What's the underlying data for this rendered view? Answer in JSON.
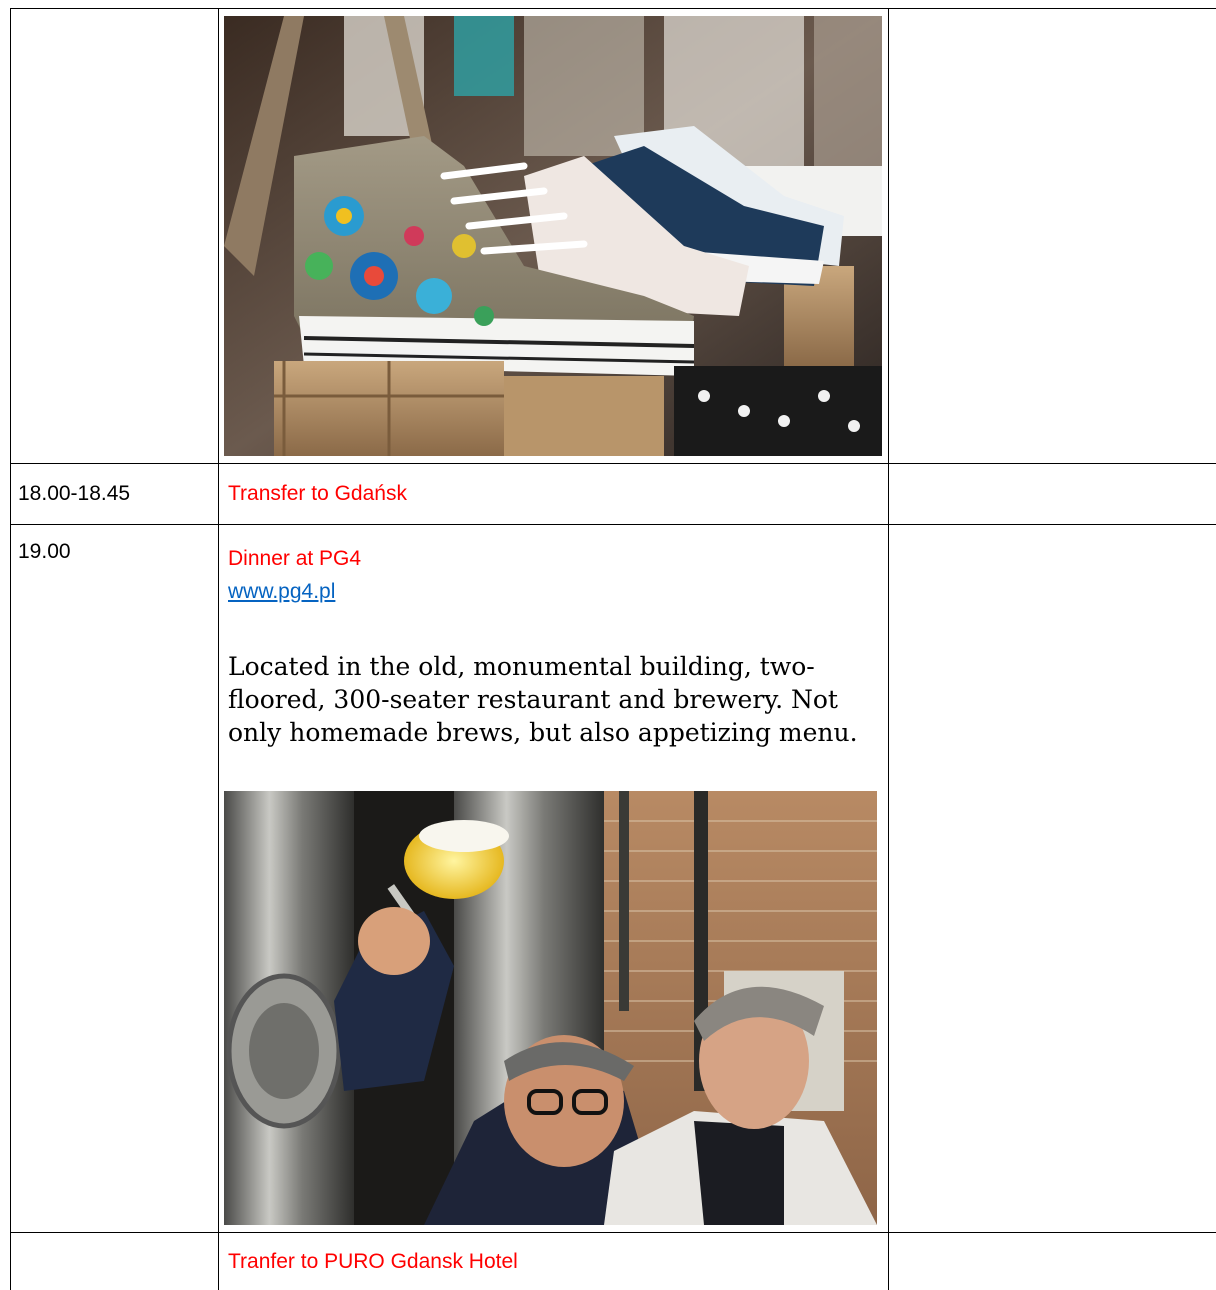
{
  "table": {
    "rows": [
      {
        "time": "",
        "activity_title": "",
        "image": "sneakers-photo",
        "notes": ""
      },
      {
        "time": "18.00-18.45",
        "activity_title": "Transfer to Gdańsk",
        "notes": ""
      },
      {
        "time": "19.00",
        "activity_title": "Dinner at PG4",
        "link": "www.pg4.pl",
        "description": "Located in the old, monumental building, two-floored, 300-seater restaurant and brewery. Not only homemade brews, but also appetizing menu.",
        "image": "brewery-photo",
        "notes": ""
      },
      {
        "time": "",
        "activity_title": "Tranfer to PURO Gdansk Hotel",
        "notes": ""
      }
    ]
  },
  "colors": {
    "activity_text": "#ff0000",
    "link": "#0563c1",
    "border": "#000000"
  }
}
